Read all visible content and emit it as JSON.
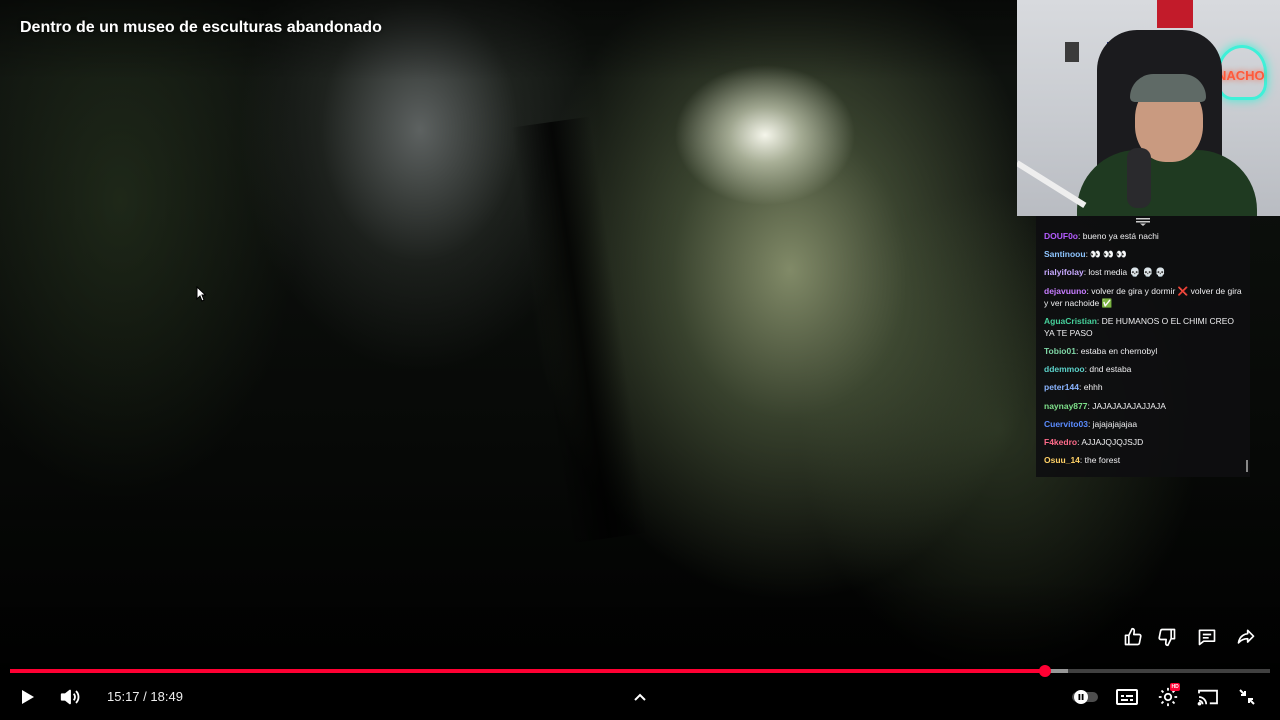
{
  "video": {
    "title": "Dentro de un museo de esculturas abandonado",
    "progress_played": 0.8211,
    "progress_buffered": 0.84
  },
  "webcam": {
    "sign_text": "NACHO"
  },
  "chat": {
    "messages": [
      {
        "user": "DOUF0o",
        "text": ": bueno ya está nachi",
        "color": "#b45cff"
      },
      {
        "user": "Santinoou",
        "text": ": 👀 👀 👀",
        "color": "#8ec5ff"
      },
      {
        "user": "rialyifolay",
        "text": ": lost media 💀 💀 💀",
        "color": "#c7a9ff"
      },
      {
        "user": "dejavuuno",
        "text": ": volver de gira y dormir ❌ volver de gira y ver nachoide ✅",
        "color": "#c77dff"
      },
      {
        "user": "AguaCristian",
        "text": ": DE HUMANOS O EL CHIMI CREO YA TE PASO",
        "color": "#46d19b"
      },
      {
        "user": "Tobio01",
        "text": ": estaba en chernobyl",
        "color": "#7fd6a6"
      },
      {
        "user": "ddemmoo",
        "text": ": dnd estaba",
        "color": "#5bd1c9"
      },
      {
        "user": "peter144",
        "text": ": ehhh",
        "color": "#8ab4ff"
      },
      {
        "user": "naynay877",
        "text": ": JAJAJAJAJAJJAJA",
        "color": "#7ee08a"
      },
      {
        "user": "Cuervito03",
        "text": ": jajajajajajaa",
        "color": "#5b8cff"
      },
      {
        "user": "F4kedro",
        "text": ": AJJAJQJQJSJD",
        "color": "#ff6b8a"
      },
      {
        "user": "Osuu_14",
        "text": ": the forest",
        "color": "#ffd166"
      }
    ]
  },
  "actions": {
    "like_icon": "thumbs-up-icon",
    "dislike_icon": "thumbs-down-icon",
    "comments_icon": "comment-icon",
    "share_icon": "share-icon"
  },
  "controls": {
    "current_time": "15:17",
    "separator": " / ",
    "duration": "18:49",
    "settings_badge": "HD",
    "accent_color": "#ff0033"
  }
}
